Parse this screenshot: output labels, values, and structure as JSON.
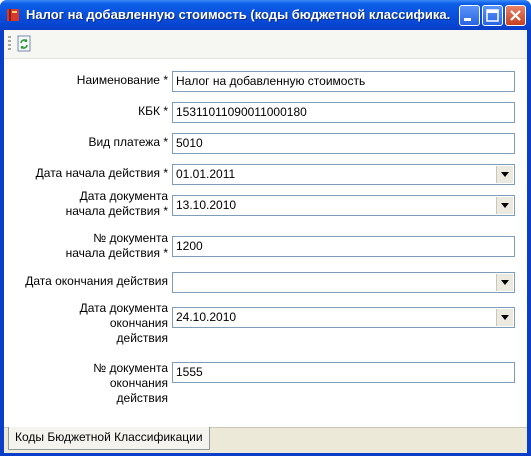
{
  "window": {
    "title": "Налог на добавленную стоимость (коды бюджетной классифика...",
    "icons": {
      "app": "book-icon",
      "minimize": "minimize-icon",
      "maximize": "maximize-icon",
      "close": "close-icon"
    }
  },
  "toolbar": {
    "refresh_icon": "refresh-icon"
  },
  "form": {
    "fields": [
      {
        "label": "Наименование *",
        "value": "Налог на добавленную стоимость"
      },
      {
        "label": "КБК *",
        "value": "15311011090011000180"
      },
      {
        "label": "Вид платежа *",
        "value": "5010"
      },
      {
        "label": "Дата начала действия *",
        "value": "01.01.2011"
      },
      {
        "label": "Дата документа\nначала действия *",
        "value": "13.10.2010"
      },
      {
        "label": "№ документа\nначала действия *",
        "value": "1200"
      },
      {
        "label": "Дата окончания действия",
        "value": ""
      },
      {
        "label": "Дата документа\nокончания\nдействия",
        "value": "24.10.2010"
      },
      {
        "label": "№ документа\nокончания\nдействия",
        "value": "1555"
      }
    ]
  },
  "tabs": [
    {
      "label": "Коды Бюджетной Классификации"
    }
  ]
}
